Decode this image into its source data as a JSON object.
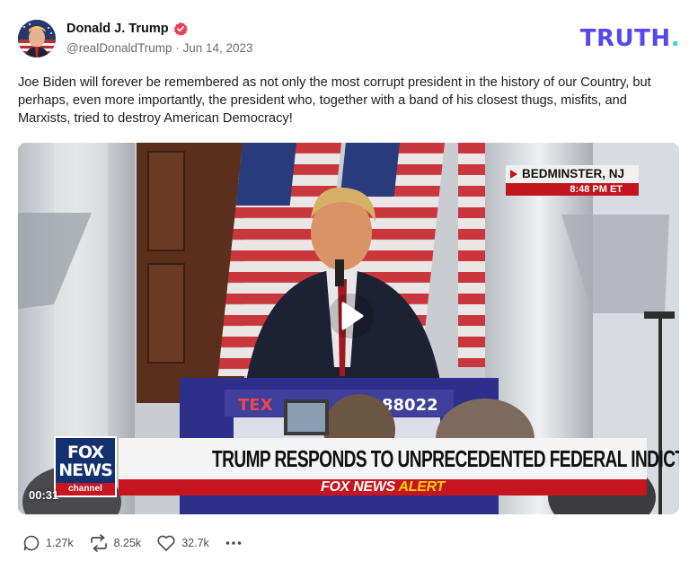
{
  "post": {
    "display_name": "Donald J. Trump",
    "handle_date": "@realDonaldTrump · Jun 14, 2023",
    "text": "Joe Biden will forever be remembered as not only the most corrupt president in the history of our Country, but perhaps, even more importantly, the president who, together with a band of his closest thugs, misfits, and Marxists, tried to destroy American Democracy!"
  },
  "brand": {
    "logo_text": "TRUTH",
    "logo_dot": ".",
    "colors": {
      "logo": "#5448ee",
      "dot": "#38d3c3",
      "verified": "#e8415a"
    }
  },
  "video": {
    "duration": "00:31",
    "location": "BEDMINSTER, NJ",
    "time": "8:48 PM ET",
    "fox_l1": "FOX",
    "fox_l2": "NEWS",
    "fox_l3": "channel",
    "headline": "TRUMP RESPONDS TO UNPRECEDENTED FEDERAL INDICTMENT",
    "alert_brand": "FOX NEWS",
    "alert_word": "ALERT",
    "podium_left": "TEX",
    "podium_right": "88022",
    "play_icon": "play-icon"
  },
  "actions": {
    "replies": "1.27k",
    "retruths": "8.25k",
    "likes": "32.7k",
    "icons": [
      "reply-icon",
      "retruth-icon",
      "like-icon",
      "more-icon"
    ]
  }
}
